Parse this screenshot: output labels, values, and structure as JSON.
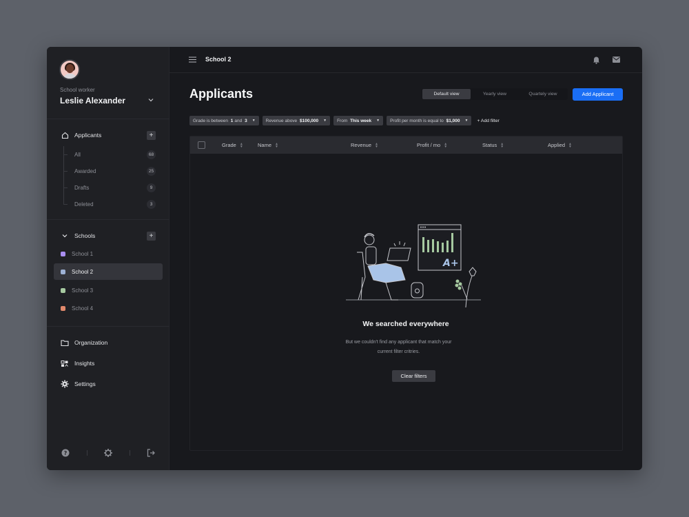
{
  "sidebar": {
    "role": "School worker",
    "user_name": "Leslie Alexander",
    "applicants": {
      "label": "Applicants",
      "items": [
        {
          "label": "All",
          "count": "68"
        },
        {
          "label": "Awarded",
          "count": "25"
        },
        {
          "label": "Drafts",
          "count": "9"
        },
        {
          "label": "Deleted",
          "count": "3"
        }
      ]
    },
    "schools": {
      "label": "Schools",
      "items": [
        {
          "label": "School 1",
          "color": "#a98ef0"
        },
        {
          "label": "School 2",
          "color": "#9db1d4"
        },
        {
          "label": "School 3",
          "color": "#a6c9a0"
        },
        {
          "label": "School 4",
          "color": "#e0896c"
        }
      ],
      "active": "School 2"
    },
    "nav": [
      {
        "label": "Organization",
        "icon": "folder-icon"
      },
      {
        "label": "Insights",
        "icon": "insights-icon"
      },
      {
        "label": "Settings",
        "icon": "gear-icon"
      }
    ],
    "footer_icons": [
      "help-icon",
      "settings-icon",
      "logout-icon"
    ]
  },
  "topbar": {
    "breadcrumb": "School 2"
  },
  "main": {
    "title": "Applicants",
    "views": [
      "Default view",
      "Yearly view",
      "Quartely view"
    ],
    "active_view": "Default view",
    "add_button": "Add Applicant",
    "filters": [
      {
        "pre": "Grade is between",
        "b1": "1",
        "mid": "and",
        "b2": "3"
      },
      {
        "pre": "Revenue above",
        "b1": "$100,000",
        "mid": "",
        "b2": ""
      },
      {
        "pre": "From",
        "b1": "This week",
        "mid": "",
        "b2": ""
      },
      {
        "pre": "Profit per month is equal to",
        "b1": "$1,000",
        "mid": "",
        "b2": ""
      }
    ],
    "add_filter": "+ Add filter",
    "columns": [
      "Grade",
      "Name",
      "Revenue",
      "Profit / mo",
      "Status",
      "Applied"
    ],
    "empty": {
      "title": "We searched everywhere",
      "body": "But we couldn't find any applicant that match your current filter critries.",
      "button": "Clear filters"
    }
  },
  "colors": {
    "accent": "#1a6ef5",
    "background": "#18191d",
    "sidebar": "#1f2024"
  }
}
